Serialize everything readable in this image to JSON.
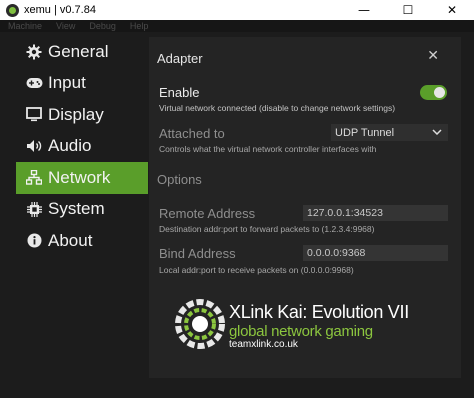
{
  "window": {
    "title": "xemu | v0.7.84",
    "controls": [
      "—",
      "☐",
      "✕"
    ]
  },
  "menu": [
    "Machine",
    "View",
    "Debug",
    "Help"
  ],
  "sidebar": {
    "items": [
      {
        "label": "General",
        "icon": "gear-icon"
      },
      {
        "label": "Input",
        "icon": "gamepad-icon"
      },
      {
        "label": "Display",
        "icon": "monitor-icon"
      },
      {
        "label": "Audio",
        "icon": "speaker-icon"
      },
      {
        "label": "Network",
        "icon": "network-icon",
        "active": true
      },
      {
        "label": "System",
        "icon": "chip-icon"
      },
      {
        "label": "About",
        "icon": "info-icon"
      }
    ]
  },
  "panel": {
    "title": "Adapter",
    "close": "✕",
    "enable": {
      "label": "Enable",
      "help": "Virtual network connected (disable to change network settings)",
      "on": true
    },
    "attached": {
      "label": "Attached to",
      "value": "UDP Tunnel",
      "help": "Controls what the virtual network controller interfaces with"
    },
    "options_heading": "Options",
    "remote": {
      "label": "Remote Address",
      "value": "127.0.0.1:34523",
      "help": "Destination addr:port to forward packets to (1.2.3.4:9968)"
    },
    "bind": {
      "label": "Bind Address",
      "value": "0.0.0.0:9368",
      "help": "Local addr:port to receive packets on (0.0.0.0:9968)"
    },
    "logo": {
      "title": "XLink Kai: Evolution VII",
      "tagline": "global network gaming",
      "url": "teamxlink.co.uk"
    }
  },
  "colors": {
    "accent": "#5a9e2a",
    "logo_green": "#8cc63f"
  }
}
